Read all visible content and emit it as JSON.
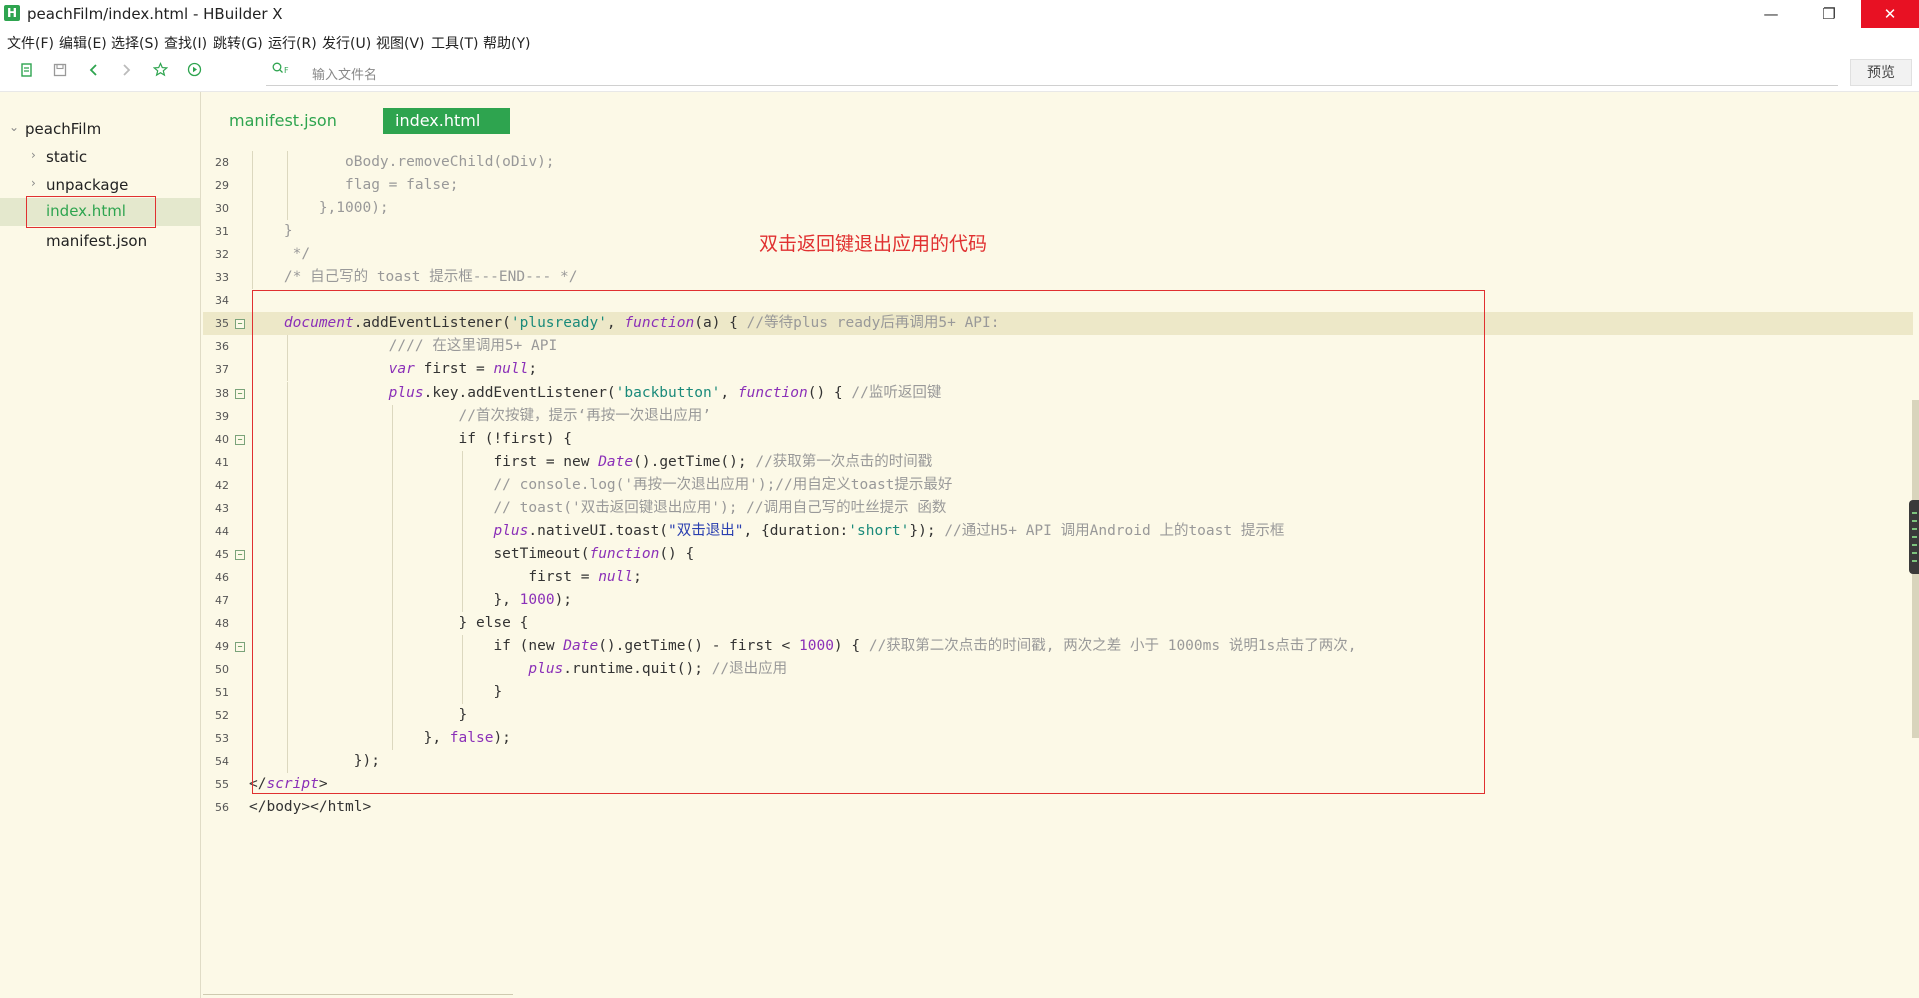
{
  "window": {
    "title": "peachFilm/index.html - HBuilder X",
    "app_icon": "H",
    "controls": [
      "—",
      "❐",
      "✕"
    ]
  },
  "menu": [
    "文件(F)",
    "编辑(E)",
    "选择(S)",
    "查找(I)",
    "跳转(G)",
    "运行(R)",
    "发行(U)",
    "视图(V)",
    "工具(T)",
    "帮助(Y)"
  ],
  "toolbar": {
    "icons": [
      "new-file-icon",
      "save-icon",
      "back-icon",
      "forward-icon",
      "star-icon",
      "run-icon"
    ],
    "search_placeholder": "输入文件名",
    "preview_label": "预览"
  },
  "sidebar": {
    "project": "peachFilm",
    "items": [
      {
        "label": "static",
        "expandable": true
      },
      {
        "label": "unpackage",
        "expandable": true
      },
      {
        "label": "index.html",
        "expandable": false,
        "selected": true
      },
      {
        "label": "manifest.json",
        "expandable": false
      }
    ]
  },
  "tabs": [
    {
      "label": "manifest.json",
      "active": false
    },
    {
      "label": "index.html",
      "active": true
    }
  ],
  "annotation": "双击返回键退出应用的代码",
  "colors": {
    "accent": "#2ea44f",
    "editor_bg": "#fcf9e7",
    "annotation_red": "#e03030",
    "close_red": "#e81123"
  },
  "code_lines": [
    {
      "n": "28",
      "indent": 11,
      "fold": false,
      "tokens": [
        [
          "c",
          "oBody.removeChild(oDiv);"
        ]
      ]
    },
    {
      "n": "29",
      "indent": 11,
      "fold": false,
      "tokens": [
        [
          "c",
          "flag = false;"
        ]
      ]
    },
    {
      "n": "30",
      "indent": 8,
      "fold": false,
      "tokens": [
        [
          "c",
          "},1000);"
        ]
      ]
    },
    {
      "n": "31",
      "indent": 4,
      "fold": false,
      "tokens": [
        [
          "c",
          "}"
        ]
      ]
    },
    {
      "n": "32",
      "indent": 4,
      "fold": false,
      "tokens": [
        [
          "c",
          " */"
        ]
      ]
    },
    {
      "n": "33",
      "indent": 4,
      "fold": false,
      "tokens": [
        [
          "c",
          "/* 自己写的 toast 提示框---END--- */"
        ]
      ]
    },
    {
      "n": "34",
      "indent": 0,
      "fold": false,
      "tokens": []
    },
    {
      "n": "35",
      "indent": 4,
      "fold": true,
      "hl": true,
      "tokens": [
        [
          "k",
          "document"
        ],
        [
          "p",
          ".addEventListener("
        ],
        [
          "s",
          "'plusready'"
        ],
        [
          "p",
          ", "
        ],
        [
          "k",
          "function"
        ],
        [
          "p",
          "(a) { "
        ],
        [
          "c",
          "//等待plus ready后再调用5+ API:"
        ]
      ]
    },
    {
      "n": "36",
      "indent": 16,
      "fold": false,
      "tokens": [
        [
          "c",
          "//// 在这里调用5+ API"
        ]
      ]
    },
    {
      "n": "37",
      "indent": 16,
      "fold": false,
      "tokens": [
        [
          "k",
          "var"
        ],
        [
          "p",
          " first = "
        ],
        [
          "k",
          "null"
        ],
        [
          "p",
          ";"
        ]
      ]
    },
    {
      "n": "38",
      "indent": 16,
      "fold": true,
      "tokens": [
        [
          "k",
          "plus"
        ],
        [
          "p",
          ".key.addEventListener("
        ],
        [
          "s",
          "'backbutton'"
        ],
        [
          "p",
          ", "
        ],
        [
          "k",
          "function"
        ],
        [
          "p",
          "() { "
        ],
        [
          "c",
          "//监听返回键"
        ]
      ]
    },
    {
      "n": "39",
      "indent": 24,
      "fold": false,
      "tokens": [
        [
          "c",
          "//首次按键，提示‘再按一次退出应用’"
        ]
      ]
    },
    {
      "n": "40",
      "indent": 24,
      "fold": true,
      "tokens": [
        [
          "p",
          "if (!first) {"
        ]
      ]
    },
    {
      "n": "41",
      "indent": 28,
      "fold": false,
      "tokens": [
        [
          "p",
          "first = new "
        ],
        [
          "k",
          "Date"
        ],
        [
          "p",
          "().getTime(); "
        ],
        [
          "c",
          "//获取第一次点击的时间戳"
        ]
      ]
    },
    {
      "n": "42",
      "indent": 28,
      "fold": false,
      "tokens": [
        [
          "c",
          "// console.log('再按一次退出应用');//用自定义toast提示最好"
        ]
      ]
    },
    {
      "n": "43",
      "indent": 28,
      "fold": false,
      "tokens": [
        [
          "c",
          "// toast('双击返回键退出应用'); //调用自己写的吐丝提示 函数"
        ]
      ]
    },
    {
      "n": "44",
      "indent": 28,
      "fold": false,
      "tokens": [
        [
          "k",
          "plus"
        ],
        [
          "p",
          ".nativeUI.toast("
        ],
        [
          "t",
          "\"双击退出\""
        ],
        [
          "p",
          ", {duration:"
        ],
        [
          "s",
          "'short'"
        ],
        [
          "p",
          "}); "
        ],
        [
          "c",
          "//通过H5+ API 调用Android 上的toast 提示框"
        ]
      ]
    },
    {
      "n": "45",
      "indent": 28,
      "fold": true,
      "tokens": [
        [
          "p",
          "setTimeout("
        ],
        [
          "k",
          "function"
        ],
        [
          "p",
          "() {"
        ]
      ]
    },
    {
      "n": "46",
      "indent": 32,
      "fold": false,
      "tokens": [
        [
          "p",
          "first = "
        ],
        [
          "k",
          "null"
        ],
        [
          "p",
          ";"
        ]
      ]
    },
    {
      "n": "47",
      "indent": 28,
      "fold": false,
      "tokens": [
        [
          "p",
          "}, "
        ],
        [
          "n",
          "1000"
        ],
        [
          "p",
          ");"
        ]
      ]
    },
    {
      "n": "48",
      "indent": 24,
      "fold": false,
      "tokens": [
        [
          "p",
          "} else {"
        ]
      ]
    },
    {
      "n": "49",
      "indent": 28,
      "fold": true,
      "tokens": [
        [
          "p",
          "if (new "
        ],
        [
          "k",
          "Date"
        ],
        [
          "p",
          "().getTime() - first < "
        ],
        [
          "n",
          "1000"
        ],
        [
          "p",
          ") { "
        ],
        [
          "c",
          "//获取第二次点击的时间戳, 两次之差 小于 1000ms 说明1s点击了两次,"
        ]
      ]
    },
    {
      "n": "50",
      "indent": 32,
      "fold": false,
      "tokens": [
        [
          "k",
          "plus"
        ],
        [
          "p",
          ".runtime.quit(); "
        ],
        [
          "c",
          "//退出应用"
        ]
      ]
    },
    {
      "n": "51",
      "indent": 28,
      "fold": false,
      "tokens": [
        [
          "p",
          "}"
        ]
      ]
    },
    {
      "n": "52",
      "indent": 24,
      "fold": false,
      "tokens": [
        [
          "p",
          "}"
        ]
      ]
    },
    {
      "n": "53",
      "indent": 20,
      "fold": false,
      "tokens": [
        [
          "p",
          "}, "
        ],
        [
          "n",
          "false"
        ],
        [
          "p",
          ");"
        ]
      ]
    },
    {
      "n": "54",
      "indent": 12,
      "fold": false,
      "tokens": [
        [
          "p",
          "});"
        ]
      ]
    },
    {
      "n": "55",
      "indent": 0,
      "fold": false,
      "tokens": [
        [
          "p",
          "</"
        ],
        [
          "k",
          "script"
        ],
        [
          "p",
          ">"
        ]
      ]
    },
    {
      "n": "56",
      "indent": 0,
      "fold": false,
      "tokens": [
        [
          "p",
          "</body></html>"
        ]
      ]
    }
  ]
}
